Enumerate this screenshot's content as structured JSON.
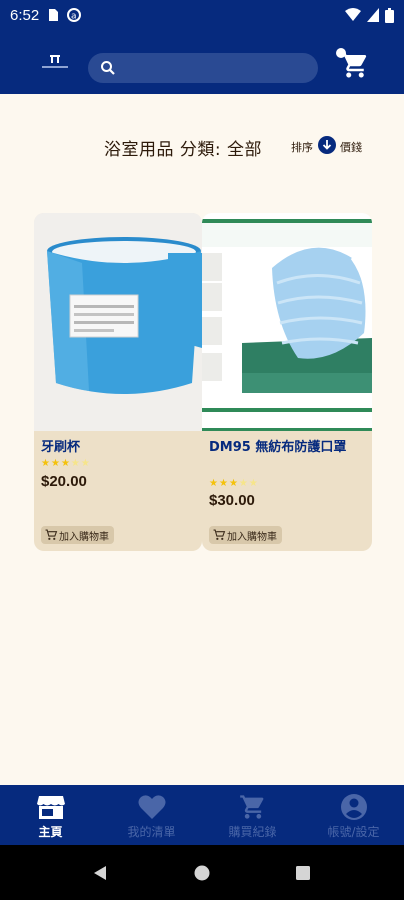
{
  "status_bar": {
    "time": "6:52"
  },
  "header": {
    "search_placeholder": "",
    "logo_text": ""
  },
  "category": {
    "title": "浴室用品 分類: 全部",
    "sort_label": "排序",
    "sort_value": "價錢"
  },
  "products": [
    {
      "name": "牙刷杯",
      "price": "$20.00",
      "rating": 3,
      "add_to_cart": "加入購物車"
    },
    {
      "name": "DM95 無紡布防護口罩",
      "price": "$30.00",
      "rating": 3,
      "add_to_cart": "加入購物車"
    }
  ],
  "bottom_nav": [
    {
      "label": "主頁",
      "icon": "store-icon",
      "active": true
    },
    {
      "label": "我的清單",
      "icon": "heart-icon",
      "active": false
    },
    {
      "label": "購買紀錄",
      "icon": "cart-icon",
      "active": false
    },
    {
      "label": "帳號/設定",
      "icon": "account-icon",
      "active": false
    }
  ],
  "colors": {
    "primary": "#062a7e",
    "background": "#fdf8ef",
    "card": "#ede0c8",
    "star": "#f4c20d"
  }
}
